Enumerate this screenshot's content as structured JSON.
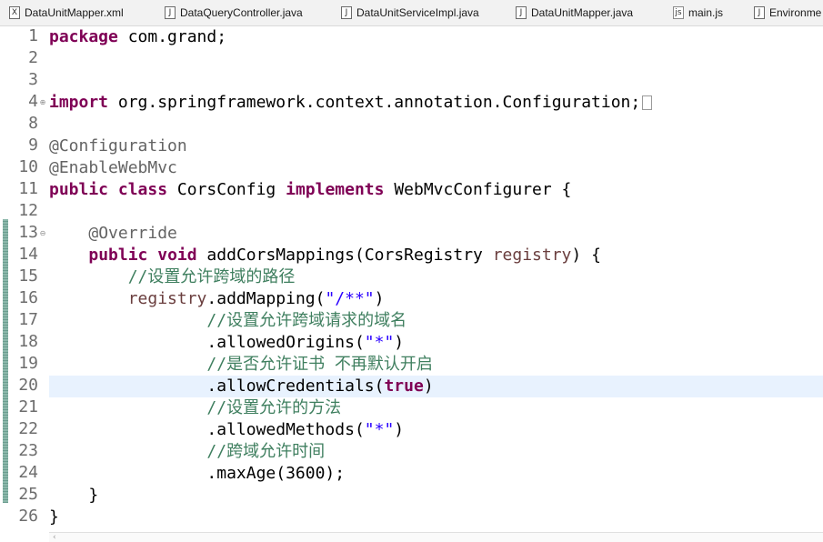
{
  "tabs": [
    {
      "label": "DataUnitMapper.xml",
      "icon": "xml-file-icon"
    },
    {
      "label": "DataQueryController.java",
      "icon": "java-file-icon"
    },
    {
      "label": "DataUnitServiceImpl.java",
      "icon": "java-file-icon"
    },
    {
      "label": "DataUnitMapper.java",
      "icon": "java-file-icon"
    },
    {
      "label": "main.js",
      "icon": "js-file-icon"
    },
    {
      "label": "Environme",
      "icon": "java-file-icon"
    }
  ],
  "editor": {
    "current_line": 20,
    "lines": [
      {
        "no": "1",
        "tokens": [
          [
            "kw",
            "package"
          ],
          [
            "plain",
            " com.grand;"
          ]
        ]
      },
      {
        "no": "2",
        "tokens": []
      },
      {
        "no": "3",
        "tokens": []
      },
      {
        "no": "4",
        "fold": "⊕",
        "collapsed": true,
        "tokens": [
          [
            "kw",
            "import"
          ],
          [
            "plain",
            " org.springframework.context.annotation.Configuration;"
          ]
        ]
      },
      {
        "no": "8",
        "tokens": []
      },
      {
        "no": "9",
        "tokens": [
          [
            "ann",
            "@Configuration"
          ]
        ]
      },
      {
        "no": "10",
        "tokens": [
          [
            "ann",
            "@EnableWebMvc"
          ]
        ]
      },
      {
        "no": "11",
        "tokens": [
          [
            "kw",
            "public"
          ],
          [
            "plain",
            " "
          ],
          [
            "kw",
            "class"
          ],
          [
            "plain",
            " CorsConfig "
          ],
          [
            "kw",
            "implements"
          ],
          [
            "plain",
            " WebMvcConfigurer {"
          ]
        ]
      },
      {
        "no": "12",
        "tokens": []
      },
      {
        "no": "13",
        "fold": "⊖",
        "tokens": [
          [
            "plain",
            "    "
          ],
          [
            "ann",
            "@Override"
          ]
        ]
      },
      {
        "no": "14",
        "tokens": [
          [
            "plain",
            "    "
          ],
          [
            "kw",
            "public"
          ],
          [
            "plain",
            " "
          ],
          [
            "kw",
            "void"
          ],
          [
            "plain",
            " addCorsMappings(CorsRegistry "
          ],
          [
            "param",
            "registry"
          ],
          [
            "plain",
            ") {"
          ]
        ]
      },
      {
        "no": "15",
        "tokens": [
          [
            "plain",
            "        "
          ],
          [
            "cm",
            "//设置允许跨域的路径"
          ]
        ]
      },
      {
        "no": "16",
        "tokens": [
          [
            "plain",
            "        "
          ],
          [
            "param",
            "registry"
          ],
          [
            "plain",
            ".addMapping("
          ],
          [
            "str",
            "\"/**\""
          ],
          [
            "plain",
            ")"
          ]
        ]
      },
      {
        "no": "17",
        "tokens": [
          [
            "plain",
            "                "
          ],
          [
            "cm",
            "//设置允许跨域请求的域名"
          ]
        ]
      },
      {
        "no": "18",
        "tokens": [
          [
            "plain",
            "                .allowedOrigins("
          ],
          [
            "str",
            "\"*\""
          ],
          [
            "plain",
            ")"
          ]
        ]
      },
      {
        "no": "19",
        "tokens": [
          [
            "plain",
            "                "
          ],
          [
            "cm",
            "//是否允许证书 不再默认开启"
          ]
        ]
      },
      {
        "no": "20",
        "tokens": [
          [
            "plain",
            "                .allowCredentials("
          ],
          [
            "kw",
            "true"
          ],
          [
            "plain",
            ")"
          ]
        ]
      },
      {
        "no": "21",
        "tokens": [
          [
            "plain",
            "                "
          ],
          [
            "cm",
            "//设置允许的方法"
          ]
        ]
      },
      {
        "no": "22",
        "tokens": [
          [
            "plain",
            "                .allowedMethods("
          ],
          [
            "str",
            "\"*\""
          ],
          [
            "plain",
            ")"
          ]
        ]
      },
      {
        "no": "23",
        "tokens": [
          [
            "plain",
            "                "
          ],
          [
            "cm",
            "//跨域允许时间"
          ]
        ]
      },
      {
        "no": "24",
        "tokens": [
          [
            "plain",
            "                .maxAge(3600);"
          ]
        ]
      },
      {
        "no": "25",
        "tokens": [
          [
            "plain",
            "    }"
          ]
        ]
      },
      {
        "no": "26",
        "tokens": [
          [
            "plain",
            "}"
          ]
        ]
      }
    ]
  },
  "colors": {
    "keyword": "#7f0055",
    "annotation": "#646464",
    "string": "#2a00ff",
    "comment": "#3f7f5f",
    "parameter": "#6a3e3e",
    "current_line": "#e8f2fe"
  }
}
